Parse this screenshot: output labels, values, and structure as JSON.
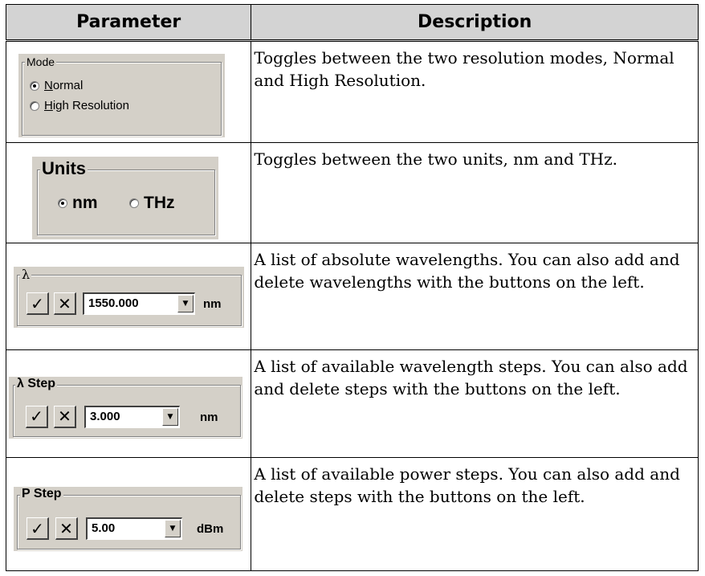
{
  "table": {
    "headers": {
      "parameter": "Parameter",
      "description": "Description"
    },
    "rows": [
      {
        "widget": {
          "type": "mode",
          "legend": "Mode",
          "options": [
            {
              "access_key": "N",
              "rest": "ormal",
              "checked": true
            },
            {
              "access_key": "H",
              "rest": "igh Resolution",
              "checked": false
            }
          ]
        },
        "description": "Toggles between the two resolution modes, Normal and High Resolution."
      },
      {
        "widget": {
          "type": "units",
          "legend": "Units",
          "options": [
            {
              "label": "nm",
              "checked": true
            },
            {
              "label": "THz",
              "checked": false
            }
          ]
        },
        "description": "Toggles between the two units, nm and THz."
      },
      {
        "widget": {
          "type": "list",
          "legend": "λ",
          "add_icon": "checkmark-icon",
          "delete_icon": "x-icon",
          "value": "1550.000",
          "unit": "nm"
        },
        "description": "A list of absolute wavelengths. You can also add and delete wavelengths with the buttons on the left."
      },
      {
        "widget": {
          "type": "list",
          "legend": "λ Step",
          "add_icon": "checkmark-icon",
          "delete_icon": "x-icon",
          "value": "3.000",
          "unit": "nm"
        },
        "description": "A list of available wavelength steps. You can also add and delete steps with the buttons on the left."
      },
      {
        "widget": {
          "type": "list",
          "legend": "P Step",
          "add_icon": "checkmark-icon",
          "delete_icon": "x-icon",
          "value": "5.00",
          "unit": "dBm"
        },
        "description": "A list of available power steps. You can also add and delete steps with the buttons on the left."
      }
    ]
  }
}
